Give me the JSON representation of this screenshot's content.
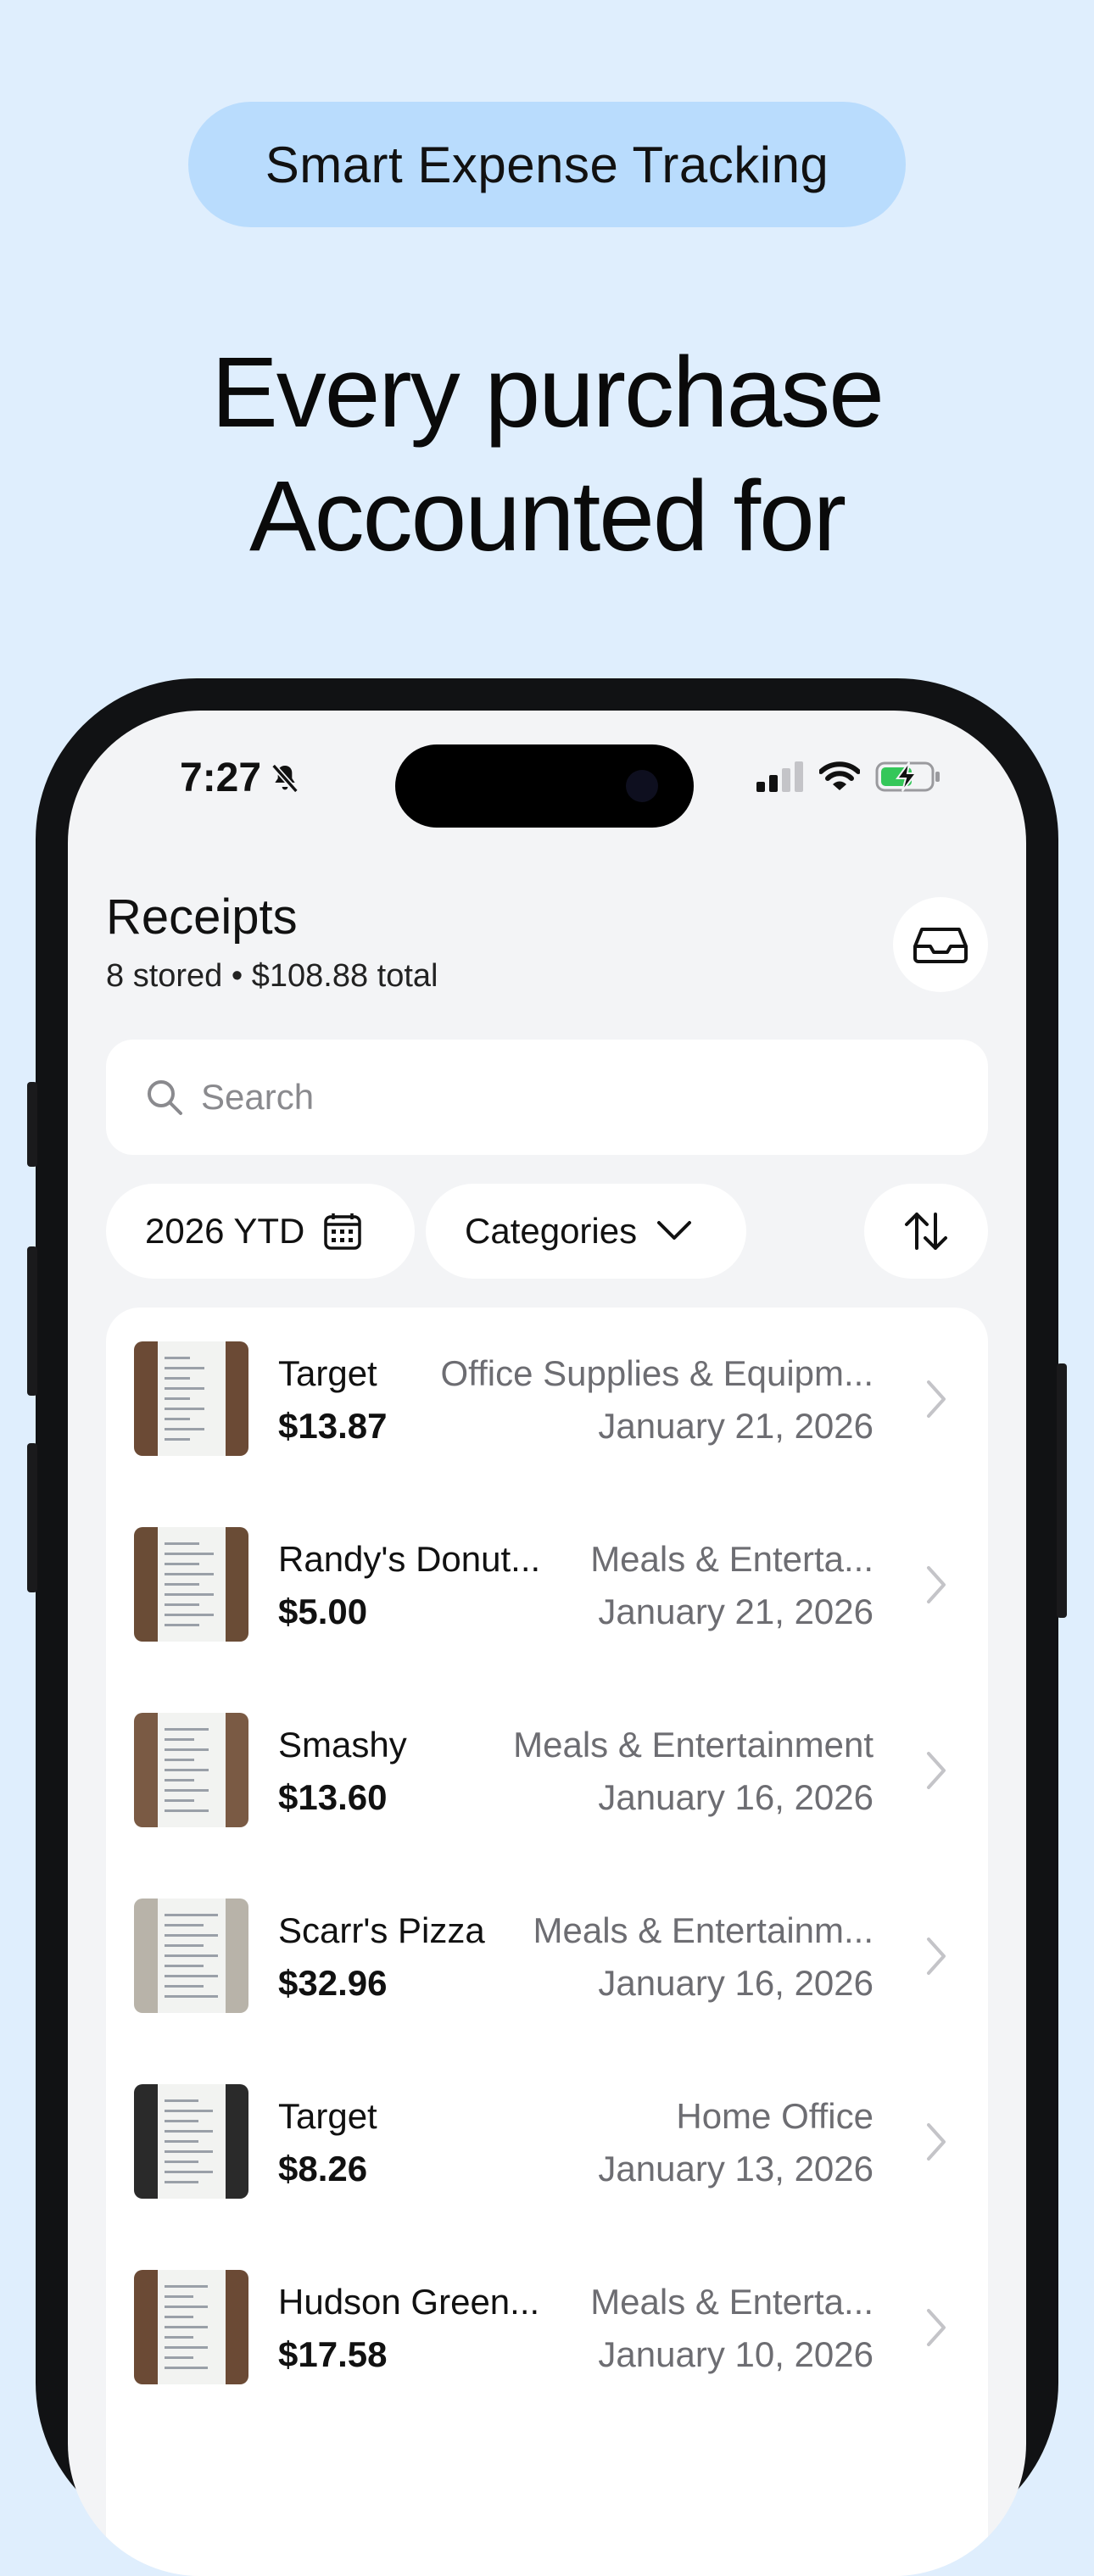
{
  "badge": "Smart Expense Tracking",
  "headline": {
    "line1": "Every purchase",
    "line2": "Accounted for"
  },
  "status_bar": {
    "time": "7:27"
  },
  "header": {
    "title": "Receipts",
    "subtitle": "8 stored • $108.88 total"
  },
  "search": {
    "placeholder": "Search"
  },
  "filters": {
    "year": "2026 YTD",
    "categories": "Categories"
  },
  "receipts": [
    {
      "merchant": "Target",
      "amount": "$13.87",
      "category": "Office Supplies & Equipm...",
      "date": "January 21, 2026"
    },
    {
      "merchant": "Randy's Donut...",
      "amount": "$5.00",
      "category": "Meals & Enterta...",
      "date": "January 21, 2026"
    },
    {
      "merchant": "Smashy",
      "amount": "$13.60",
      "category": "Meals & Entertainment",
      "date": "January 16, 2026"
    },
    {
      "merchant": "Scarr's Pizza",
      "amount": "$32.96",
      "category": "Meals & Entertainm...",
      "date": "January 16, 2026"
    },
    {
      "merchant": "Target",
      "amount": "$8.26",
      "category": "Home Office",
      "date": "January 13, 2026"
    },
    {
      "merchant": "Hudson Green...",
      "amount": "$17.58",
      "category": "Meals & Enterta...",
      "date": "January 10, 2026"
    }
  ],
  "colors": {
    "background": "#dfeefd",
    "badge": "#b9dcfd",
    "battery_charge": "#34c759"
  }
}
